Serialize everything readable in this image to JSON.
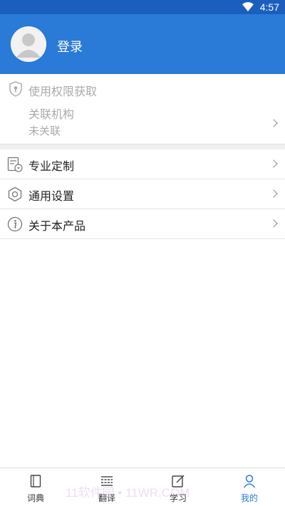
{
  "status_bar": {
    "time": "4:57",
    "wifi_icon": "wifi-icon"
  },
  "header": {
    "login_label": "登录",
    "avatar_icon": "default-avatar-icon"
  },
  "permissions": {
    "title": "使用权限获取",
    "org_label": "关联机构",
    "org_status": "未关联"
  },
  "menu": {
    "items": [
      {
        "label": "专业定制",
        "icon": "document-customize-icon"
      },
      {
        "label": "通用设置",
        "icon": "gear-icon"
      },
      {
        "label": "关于本产品",
        "icon": "info-icon"
      }
    ]
  },
  "bottom_nav": {
    "items": [
      {
        "label": "词典",
        "icon": "book-icon"
      },
      {
        "label": "翻译",
        "icon": "translate-icon"
      },
      {
        "label": "学习",
        "icon": "edit-icon"
      },
      {
        "label": "我的",
        "icon": "person-icon",
        "active": true
      }
    ]
  },
  "watermark": "11软件园 • 11WR.COM",
  "colors": {
    "header": "#2a7ad7",
    "status_bar": "#1b5fbe",
    "active_nav": "#2a7ad7"
  }
}
